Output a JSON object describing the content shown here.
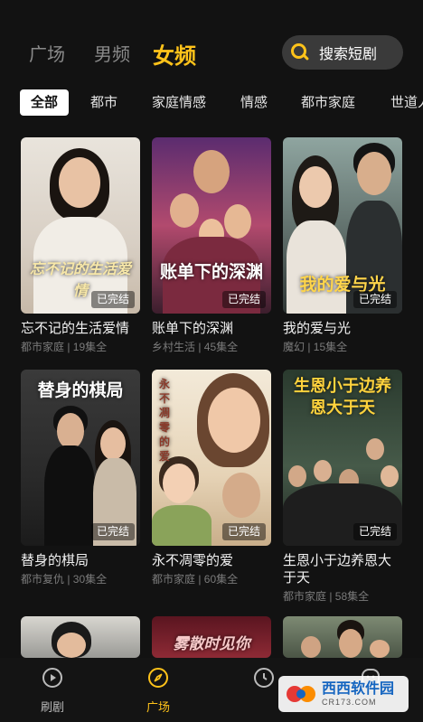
{
  "header": {
    "tabs": [
      "广场",
      "男频"
    ],
    "active_tab": "女频",
    "search_placeholder": "搜索短剧"
  },
  "categories": [
    "全部",
    "都市",
    "家庭情感",
    "情感",
    "都市家庭",
    "世道人心"
  ],
  "dramas": [
    {
      "title": "忘不记的生活爱情",
      "meta": "都市家庭 | 19集全",
      "badge": "已完结",
      "poster_text": "忘不记的生活爱情"
    },
    {
      "title": "账单下的深渊",
      "meta": "乡村生活 | 45集全",
      "badge": "已完结",
      "poster_text": "账单下的深渊"
    },
    {
      "title": "我的爱与光",
      "meta": "魔幻 | 15集全",
      "badge": "已完结",
      "poster_text": "我的爱与光"
    },
    {
      "title": "替身的棋局",
      "meta": "都市复仇 | 30集全",
      "badge": "已完结",
      "poster_text": "替身的棋局"
    },
    {
      "title": "永不凋零的爱",
      "meta": "都市家庭 | 60集全",
      "badge": "已完结",
      "poster_text": "永不凋零的爱"
    },
    {
      "title": "生恩小于边养恩大于天",
      "meta": "都市家庭 | 58集全",
      "badge": "已完结",
      "poster_text": "生恩小于边养恩大于天"
    },
    {
      "poster_text": ""
    },
    {
      "poster_text": "雾散时见你"
    },
    {
      "poster_text": ""
    }
  ],
  "bottom_nav": [
    {
      "label": "刷剧",
      "icon": "play-circle-icon"
    },
    {
      "label": "广场",
      "icon": "compass-icon"
    }
  ],
  "watermark": {
    "main": "西西软件园",
    "sub": "CR173.COM"
  },
  "colors": {
    "accent": "#ffc31a",
    "background": "#121212"
  }
}
